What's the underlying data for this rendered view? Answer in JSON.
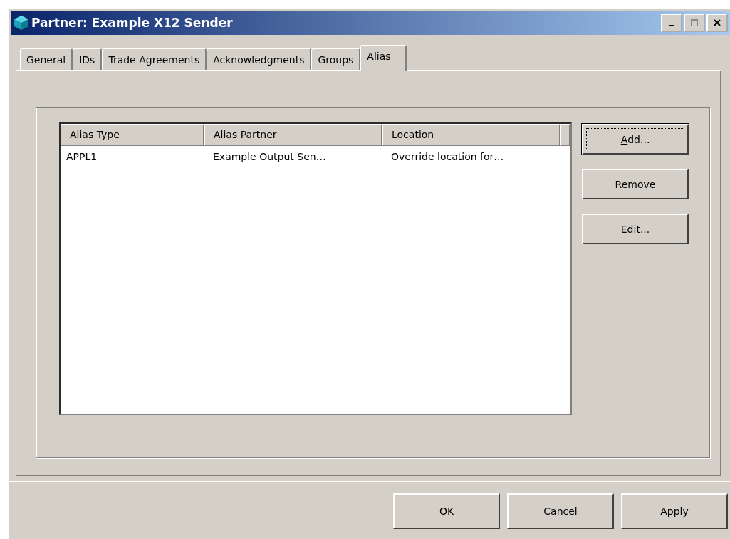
{
  "window": {
    "title": "Partner: Example X12 Sender"
  },
  "tabs": [
    {
      "label": "General",
      "selected": false
    },
    {
      "label": "IDs",
      "selected": false
    },
    {
      "label": "Trade Agreements",
      "selected": false
    },
    {
      "label": "Acknowledgments",
      "selected": false
    },
    {
      "label": "Groups",
      "selected": false
    },
    {
      "label": "Alias",
      "selected": true
    }
  ],
  "table": {
    "columns": [
      "Alias Type",
      "Alias Partner",
      "Location"
    ],
    "rows": [
      [
        "APPL1",
        "Example Output Sen…",
        "Override location for…"
      ]
    ]
  },
  "side_buttons": [
    {
      "label": "Add...",
      "access_key": true,
      "default": true
    },
    {
      "label": "Remove",
      "access_key": true,
      "default": false
    },
    {
      "label": "Edit...",
      "access_key": true,
      "default": false
    }
  ],
  "dialog_buttons": [
    {
      "label": "OK",
      "access_key": false
    },
    {
      "label": "Cancel",
      "access_key": false
    },
    {
      "label": "Apply",
      "access_key": true
    }
  ]
}
